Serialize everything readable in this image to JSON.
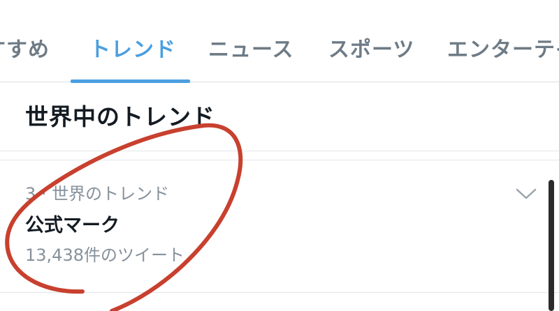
{
  "tabs": [
    {
      "label": "すすめ"
    },
    {
      "label": "トレンド",
      "active": true
    },
    {
      "label": "ニュース"
    },
    {
      "label": "スポーツ"
    },
    {
      "label": "エンターテイ"
    }
  ],
  "section": {
    "title": "世界中のトレンド"
  },
  "trend": {
    "context": "3 · 世界のトレンド",
    "name": "公式マーク",
    "count": "13,438件のツイート"
  },
  "colors": {
    "accent": "#4a9fe0",
    "annotation": "#c8402e",
    "muted_text": "#86919b",
    "primary_text": "#141b22"
  },
  "icons": {
    "trend_menu": "chevron-down-icon"
  }
}
